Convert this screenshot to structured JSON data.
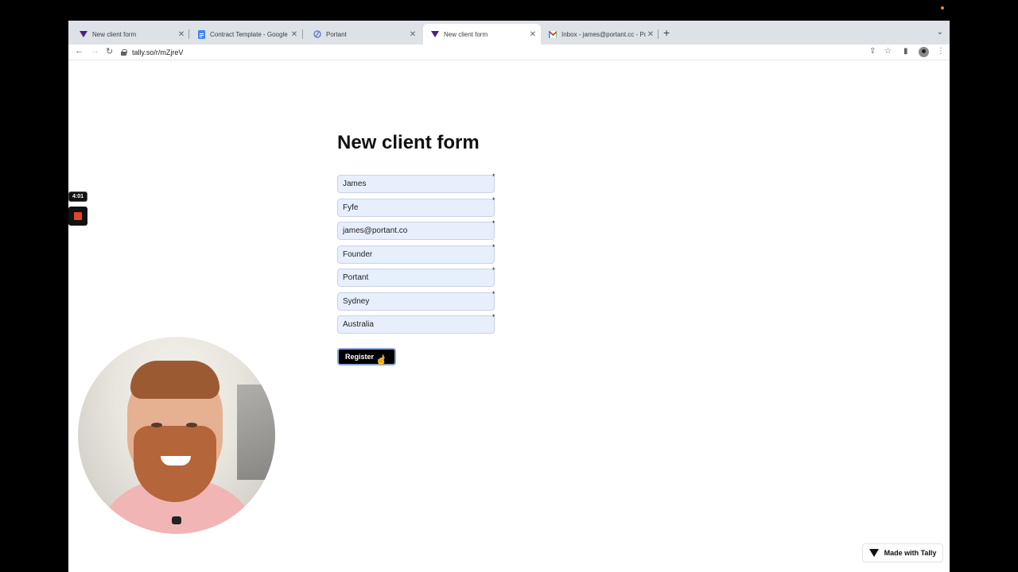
{
  "browser": {
    "tabs": [
      {
        "title": "New client form",
        "favicon": "tally-icon",
        "active": false
      },
      {
        "title": "Contract Template - Google Docs",
        "favicon": "google-docs-icon",
        "active": false
      },
      {
        "title": "Portant",
        "favicon": "portant-icon",
        "active": false
      },
      {
        "title": "New client form",
        "favicon": "tally-icon",
        "active": true
      },
      {
        "title": "Inbox - james@portant.cc - Portant",
        "favicon": "gmail-icon",
        "active": false
      }
    ],
    "url": "tally.so/r/mZjreV"
  },
  "form": {
    "title": "New client form",
    "fields": [
      {
        "value": "James",
        "required": "*"
      },
      {
        "value": "Fyfe",
        "required": "*"
      },
      {
        "value": "james@portant.co",
        "required": "*"
      },
      {
        "value": "Founder",
        "required": "*"
      },
      {
        "value": "Portant",
        "required": "*"
      },
      {
        "value": "Sydney",
        "required": "*"
      },
      {
        "value": "Australia",
        "required": "*"
      }
    ],
    "submit_label": "Register",
    "submit_arrow": "→"
  },
  "footer": {
    "made_with": "Made with Tally"
  },
  "recorder": {
    "timer": "4:01"
  },
  "colors": {
    "field_bg": "#e7effd",
    "stop": "#e0442b",
    "button": "#000000"
  }
}
